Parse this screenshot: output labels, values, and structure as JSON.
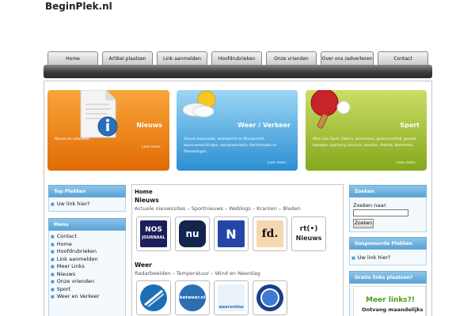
{
  "site": {
    "title": "BeginPlek.nl"
  },
  "nav": {
    "tabs": [
      {
        "label": "Home"
      },
      {
        "label": "Artikel plaatsen"
      },
      {
        "label": "Link aanmelden"
      },
      {
        "label": "Hoofdrubrieken"
      },
      {
        "label": "Onze vrienden"
      },
      {
        "label": "Over ons /adverteren"
      },
      {
        "label": "Contact"
      }
    ]
  },
  "features": [
    {
      "title": "Nieuws",
      "description": "Nieuws en actualiteit",
      "more": "Lees meer..",
      "icon": "info-document-icon"
    },
    {
      "title": "Weer / Verkeer",
      "description": "Actuele buienradar, weerbericht en filevoorzicht, weersverwachtingen, weerpresentatie, fileinformatie en filemeldingen.",
      "more": "Lees meer..",
      "icon": "sun-cloud-icon"
    },
    {
      "title": "Sport",
      "description": "Alles over Sport, Video's, livestreams, gezond leefstijl, gezond bewegen, sportzorg, blessure, Aerobics, Atletiek, Badminton.",
      "more": "Lees meer..",
      "icon": "ping-pong-icon"
    }
  ],
  "left": {
    "top_plekken": {
      "heading": "Top Plekken",
      "items": [
        "Uw link hier?"
      ]
    },
    "menu": {
      "heading": "Menu",
      "items": [
        "Contact",
        "Home",
        "Hoofdrubrieken",
        "Link aanmelden",
        "Meer Links",
        "Nieuws",
        "Onze vrienden",
        "Sport",
        "Weer en Verkeer"
      ]
    }
  },
  "main": {
    "breadcrumb": "Home",
    "nieuws": {
      "heading": "Nieuws",
      "subheading": "Actuele nieuwssites – Sportnieuws – Weblogs – Kranten – Bladen",
      "tiles": [
        {
          "label": "NOS",
          "sub": "JOURNAAL",
          "color": "#1a1f5c"
        },
        {
          "label": "nu",
          "color": "#13254d"
        },
        {
          "label": "N",
          "color": "#2546a8"
        },
        {
          "label": "fd.",
          "color": "#f5d7b0"
        },
        {
          "label": "rt(•)",
          "sub": "Nieuws",
          "color": "#ffffff"
        }
      ]
    },
    "weer": {
      "heading": "Weer",
      "subheading": "Radarbeelden – Temperatuur – Wind en Neerslag",
      "tiles": [
        {
          "label": "",
          "color": "#1c6fb5"
        },
        {
          "label": "betweer.nl",
          "color": "#2b6fb3"
        },
        {
          "label": "weeronline",
          "color": "#e8f2f8"
        },
        {
          "label": "",
          "color": "#1a3f8a"
        }
      ]
    }
  },
  "right": {
    "zoeken": {
      "heading": "Zoeken",
      "label": "Zoeken naar:",
      "input_value": "",
      "button": "Zoeken"
    },
    "gesponsorde": {
      "heading": "Gesponsorde Plekken",
      "items": [
        "Uw link hier?"
      ]
    },
    "gratis": {
      "heading": "Gratis links plaatsen?",
      "promo_title": "Meer links?!",
      "promo_sub": "Ontvang maandelijks"
    }
  },
  "colors": {
    "accent_blue": "#5aa3d6",
    "nav_dark": "#2a2a2a"
  }
}
